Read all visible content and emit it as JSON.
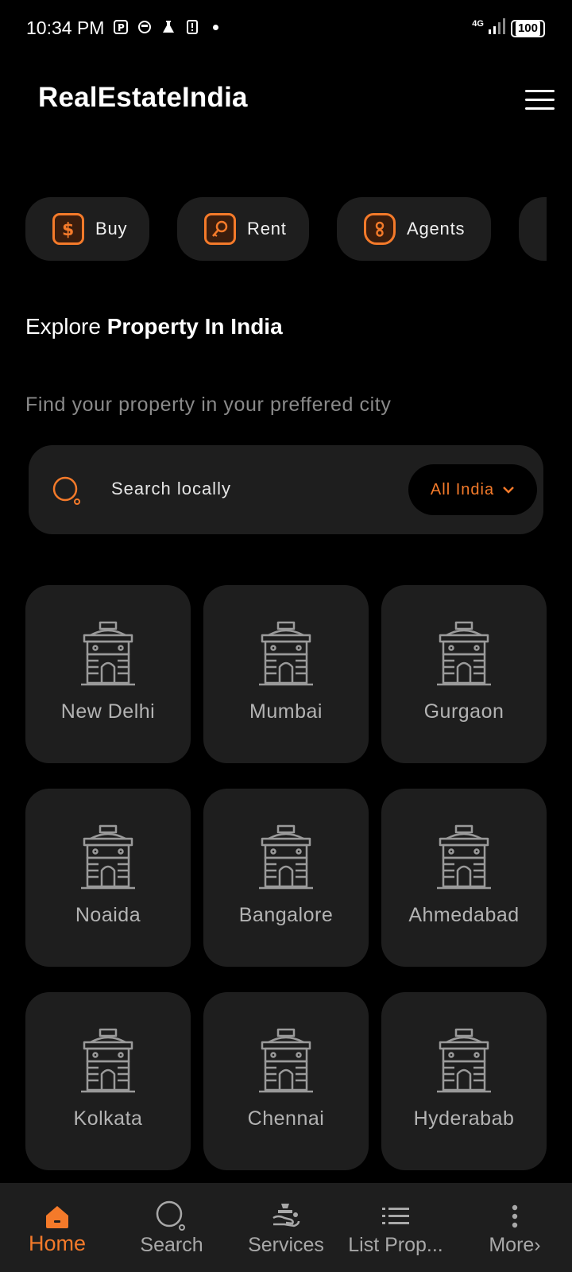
{
  "status_bar": {
    "time": "10:34 PM",
    "network": "4G",
    "battery": "100"
  },
  "header": {
    "title": "RealEstateIndia"
  },
  "chips": [
    {
      "label": "Buy",
      "icon": "dollar-icon"
    },
    {
      "label": "Rent",
      "icon": "key-icon"
    },
    {
      "label": "Agents",
      "icon": "agent-badge-icon"
    }
  ],
  "explore": {
    "prefix": "Explore",
    "highlight": "Property In India",
    "subtitle": "Find your property in your preffered city"
  },
  "search": {
    "placeholder": "Search locally",
    "scope": "All India"
  },
  "cities": [
    {
      "name": "New Delhi"
    },
    {
      "name": "Mumbai"
    },
    {
      "name": "Gurgaon"
    },
    {
      "name": "Noaida"
    },
    {
      "name": "Bangalore"
    },
    {
      "name": "Ahmedabad"
    },
    {
      "name": "Kolkata"
    },
    {
      "name": "Chennai"
    },
    {
      "name": "Hyderabab"
    }
  ],
  "bottom_nav": [
    {
      "label": "Home",
      "icon": "home-icon",
      "active": true
    },
    {
      "label": "Search",
      "icon": "search-icon"
    },
    {
      "label": "Services",
      "icon": "services-icon"
    },
    {
      "label": "List Prop...",
      "icon": "list-icon"
    },
    {
      "label": "More›",
      "icon": "more-icon"
    }
  ],
  "colors": {
    "accent": "#f47a2a",
    "background": "#000000",
    "card": "#1e1e1e"
  }
}
